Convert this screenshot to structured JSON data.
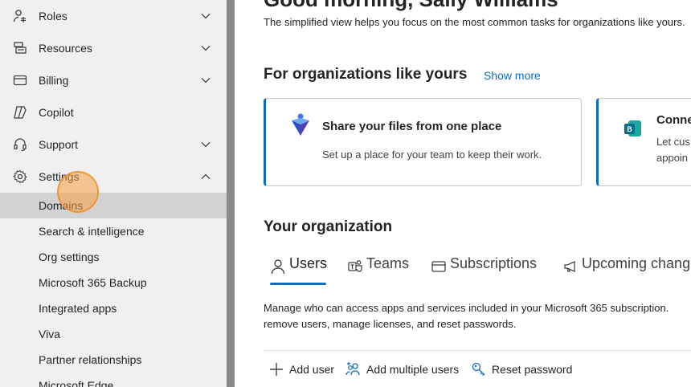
{
  "sidebar": {
    "items": [
      {
        "label": "Roles",
        "icon": "roles-icon",
        "expandable": true
      },
      {
        "label": "Resources",
        "icon": "resources-icon",
        "expandable": true
      },
      {
        "label": "Billing",
        "icon": "billing-icon",
        "expandable": true
      },
      {
        "label": "Copilot",
        "icon": "copilot-icon",
        "expandable": false
      },
      {
        "label": "Support",
        "icon": "headset-icon",
        "expandable": true
      },
      {
        "label": "Settings",
        "icon": "gear-icon",
        "expandable": true,
        "expanded": true
      }
    ],
    "settings_children": [
      {
        "label": "Domains",
        "active": true
      },
      {
        "label": "Search & intelligence"
      },
      {
        "label": "Org settings"
      },
      {
        "label": "Microsoft 365 Backup"
      },
      {
        "label": "Integrated apps"
      },
      {
        "label": "Viva"
      },
      {
        "label": "Partner relationships"
      },
      {
        "label": "Microsoft Edge"
      }
    ]
  },
  "main": {
    "greeting": "Good morning, Sally Williams",
    "subtitle": "The simplified view helps you focus on the most common tasks for organizations like yours.",
    "orgs_section": {
      "title": "For organizations like yours",
      "show_more": "Show more",
      "cards": [
        {
          "title": "Share your files from one place",
          "description": "Set up a place for your team to keep their work."
        },
        {
          "title": "Connect",
          "description": "Let cus",
          "description2": "appoin"
        }
      ]
    },
    "your_org": {
      "title": "Your organization",
      "tabs": [
        {
          "label": "Users",
          "icon": "person-icon",
          "selected": true
        },
        {
          "label": "Teams",
          "icon": "teams-icon"
        },
        {
          "label": "Subscriptions",
          "icon": "subscriptions-icon"
        },
        {
          "label": "Upcoming changes",
          "icon": "megaphone-icon"
        }
      ],
      "description_line1": "Manage who can access apps and services included in your Microsoft 365 subscription.",
      "description_line2": "remove users, manage licenses, and reset passwords.",
      "actions": [
        {
          "label": "Add user",
          "icon": "plus-icon"
        },
        {
          "label": "Add multiple users",
          "icon": "add-multiple-users-icon"
        },
        {
          "label": "Reset password",
          "icon": "reset-password-icon"
        }
      ]
    }
  },
  "colors": {
    "accent": "#0f6cbd",
    "sidebar_bg": "#f0f0f0",
    "active_row": "#d2d2d2",
    "cursor_highlight": "#f5a046"
  }
}
